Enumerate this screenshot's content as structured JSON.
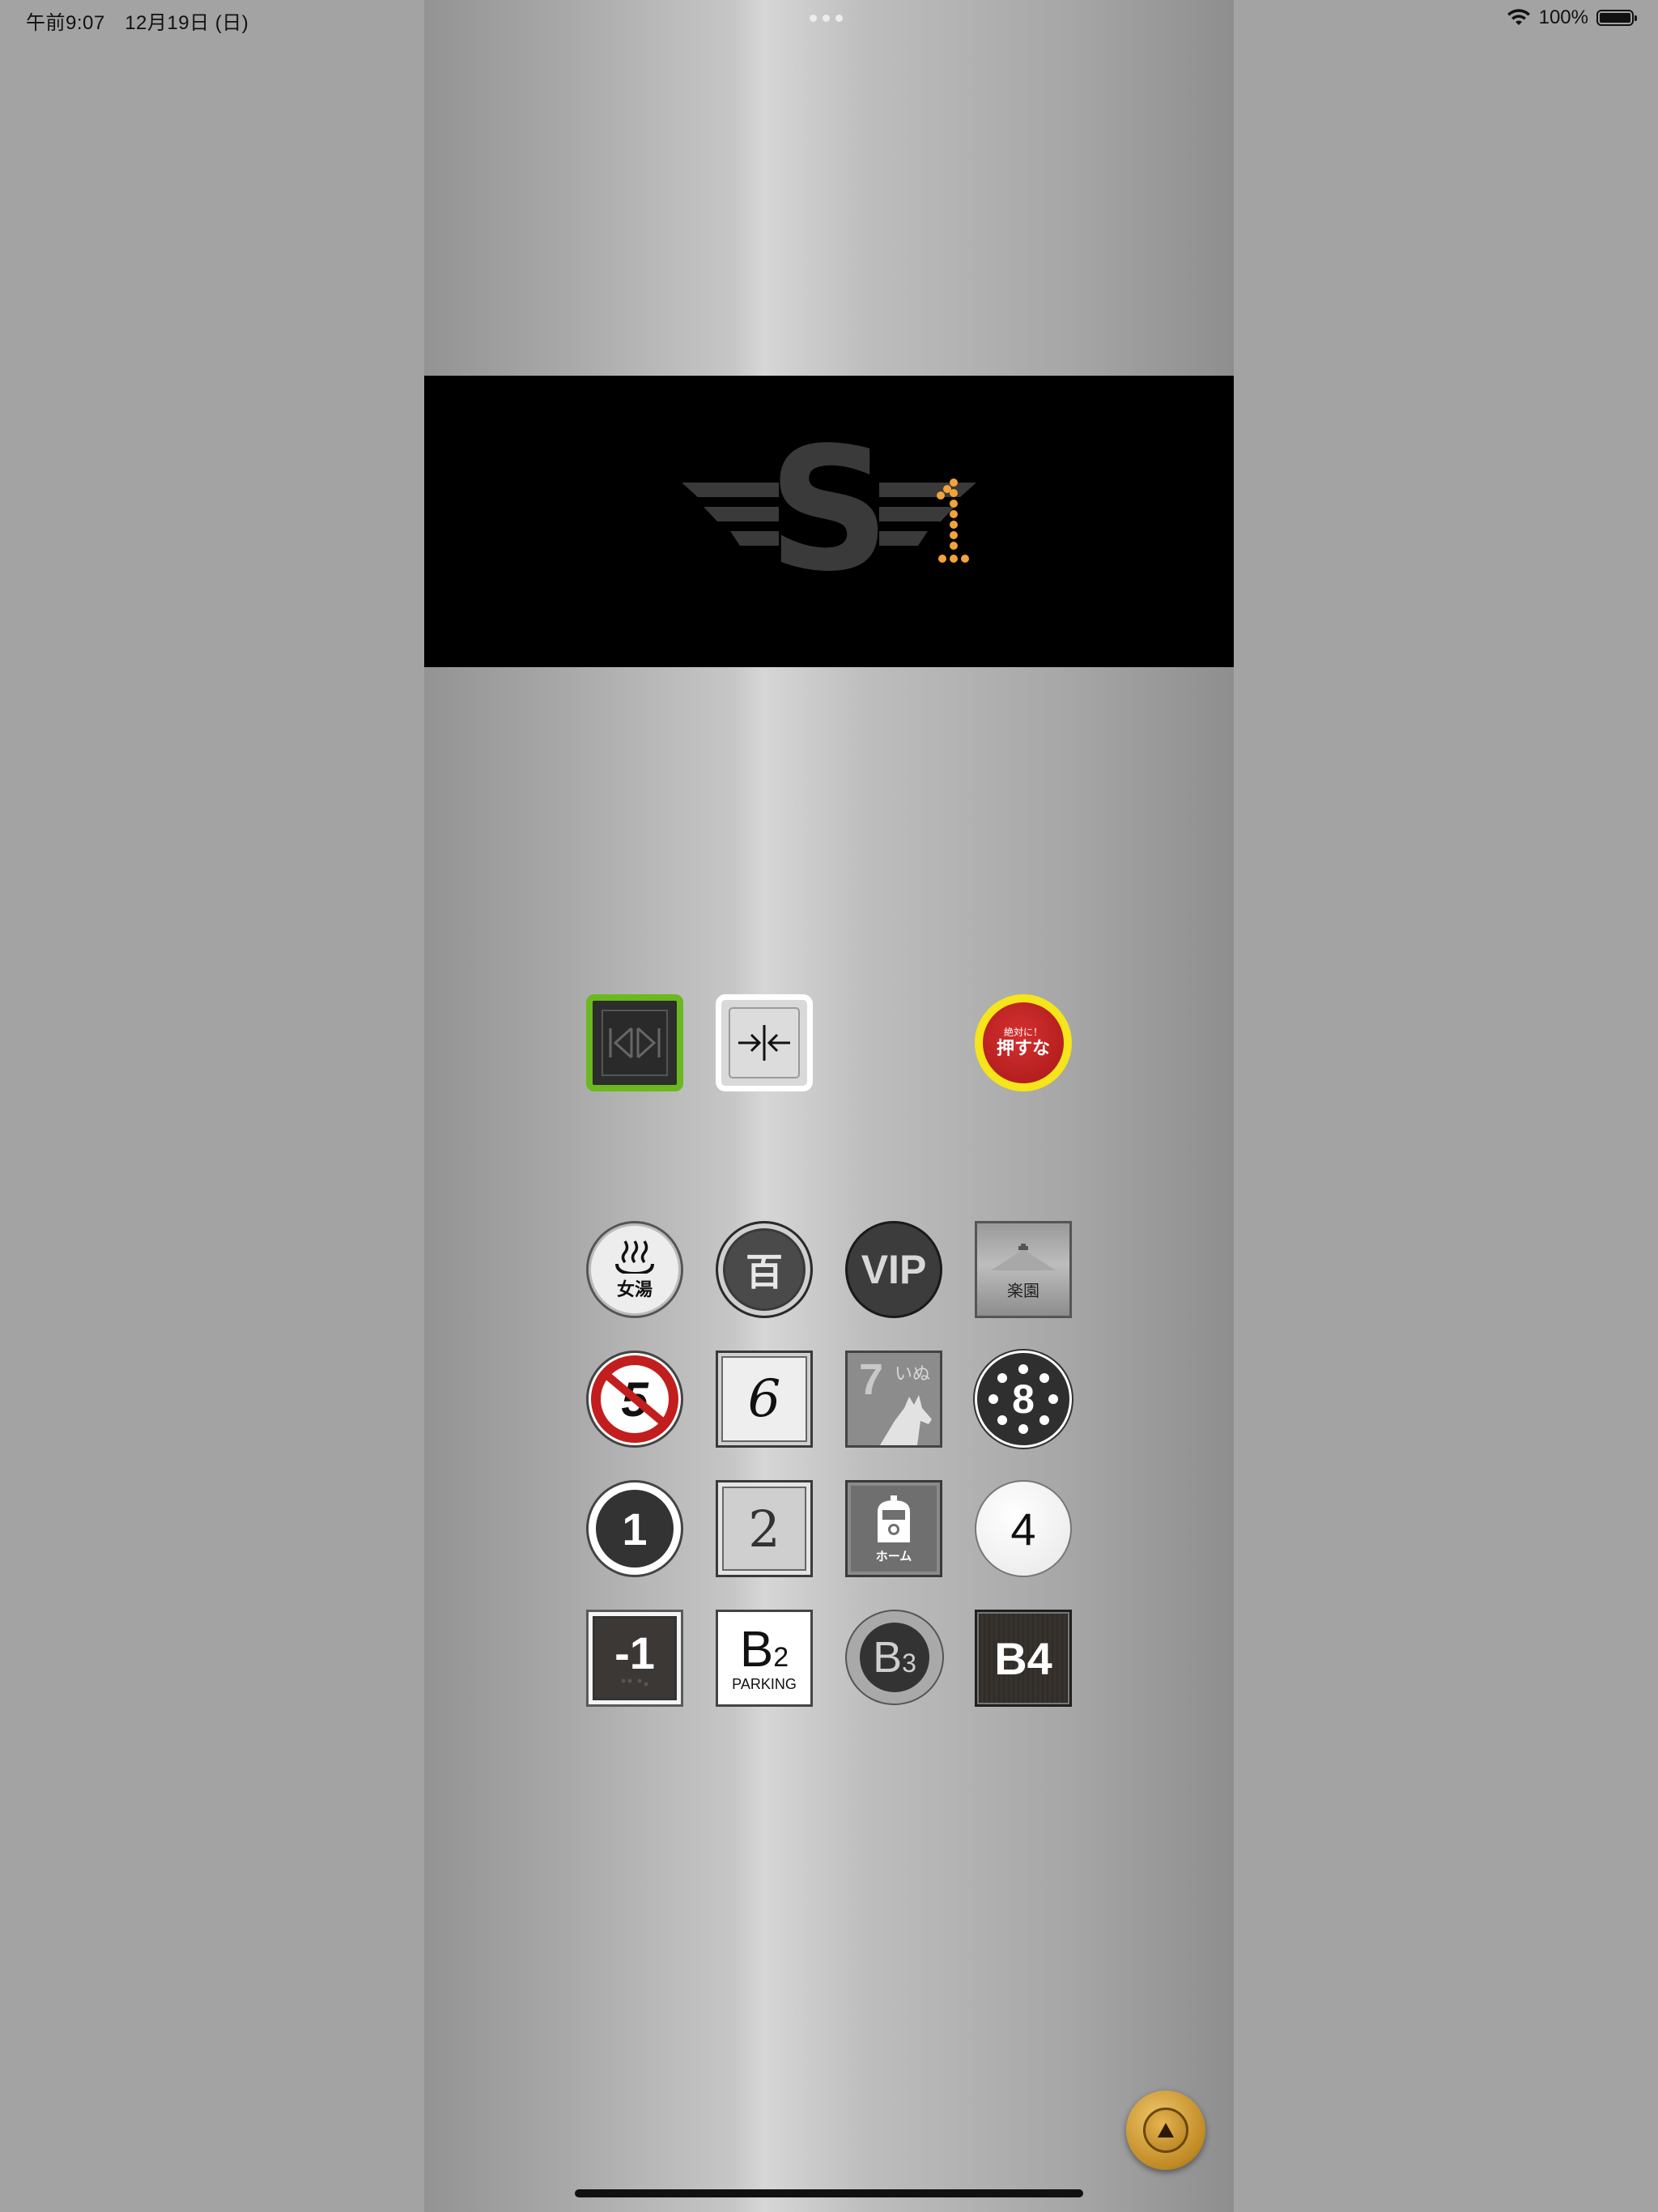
{
  "status_bar": {
    "time_date": "午前9:07　12月19日 (日)",
    "battery_text": "100%",
    "battery_level": 1.0
  },
  "display": {
    "logo_letter": "S",
    "current_floor": "1",
    "floor_digit_color": "#f2a33a"
  },
  "controls": {
    "open_button_icon": "door-open-icon",
    "close_button_icon": "door-close-icon",
    "emergency_small": "絶対に！",
    "emergency_big": "押すな"
  },
  "buttons": {
    "womens_bath": "女湯",
    "hyaku": "百",
    "vip": "VIP",
    "rakuen": "楽園",
    "f5": "5",
    "f6": "6",
    "f7": "7",
    "f7_sub": "いぬ",
    "f8": "8",
    "f1": "1",
    "f2": "2",
    "home": "ホーム",
    "f4": "4",
    "minus1": "-1",
    "b2_main": "B",
    "b2_sub": "2",
    "b2_label": "PARKING",
    "b3_main": "B",
    "b3_sub": "3",
    "b4": "B4"
  },
  "colors": {
    "open_border": "#6cb820",
    "emergency_ring": "#f5e51a",
    "emergency_fill": "#c22222",
    "no_entry_red": "#c21e1e"
  }
}
